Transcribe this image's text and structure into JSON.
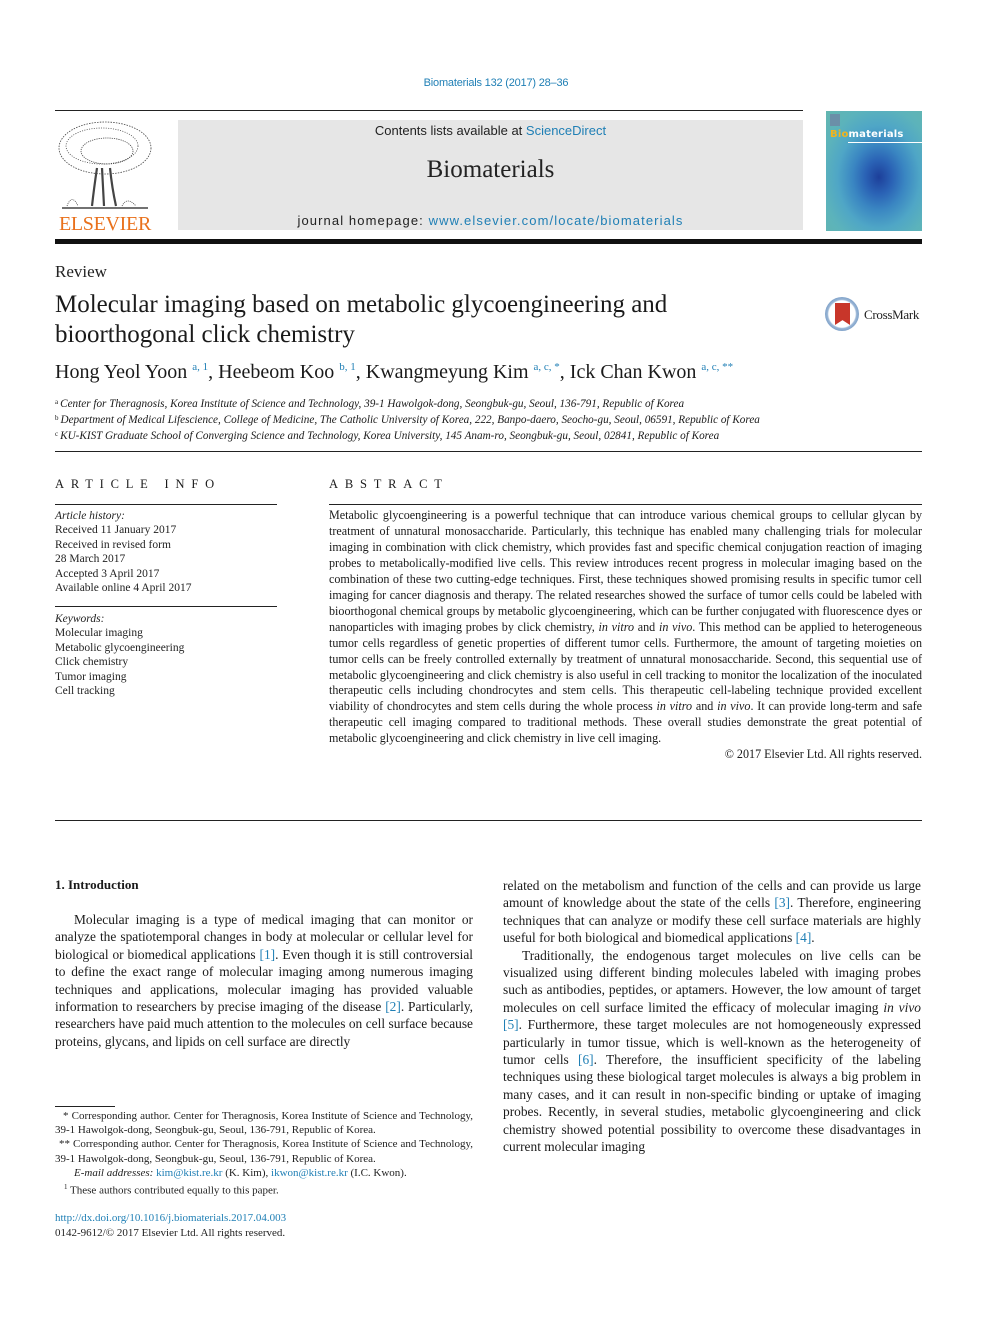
{
  "header": {
    "journal_ref": "Biomaterials 132 (2017) 28–36",
    "contents_prefix": "Contents lists available at ",
    "contents_link": "ScienceDirect",
    "journal_title": "Biomaterials",
    "homepage_prefix": "journal homepage: ",
    "homepage_link": "www.elsevier.com/locate/biomaterials",
    "publisher_logo_text": "ELSEVIER",
    "cover_title_highlight": "Bio",
    "cover_title_rest": "materials"
  },
  "article": {
    "type": "Review",
    "title": "Molecular imaging based on metabolic glycoengineering and bioorthogonal click chemistry",
    "crossmark_label": "CrossMark",
    "authors": [
      {
        "name": "Hong Yeol Yoon",
        "marks": "a, 1"
      },
      {
        "name": "Heebeom Koo",
        "marks": "b, 1"
      },
      {
        "name": "Kwangmeyung Kim",
        "marks": "a, c, *"
      },
      {
        "name": "Ick Chan Kwon",
        "marks": "a, c, **"
      }
    ],
    "affiliations": [
      {
        "key": "a",
        "text": "Center for Theragnosis, Korea Institute of Science and Technology, 39-1 Hawolgok-dong, Seongbuk-gu, Seoul, 136-791, Republic of Korea"
      },
      {
        "key": "b",
        "text": "Department of Medical Lifescience, College of Medicine, The Catholic University of Korea, 222, Banpo-daero, Seocho-gu, Seoul, 06591, Republic of Korea"
      },
      {
        "key": "c",
        "text": "KU-KIST Graduate School of Converging Science and Technology, Korea University, 145 Anam-ro, Seongbuk-gu, Seoul, 02841, Republic of Korea"
      }
    ]
  },
  "article_info": {
    "heading": "ARTICLE INFO",
    "history_label": "Article history:",
    "history": [
      "Received 11 January 2017",
      "Received in revised form",
      "28 March 2017",
      "Accepted 3 April 2017",
      "Available online 4 April 2017"
    ],
    "keywords_label": "Keywords:",
    "keywords": [
      "Molecular imaging",
      "Metabolic glycoengineering",
      "Click chemistry",
      "Tumor imaging",
      "Cell tracking"
    ]
  },
  "abstract": {
    "heading": "ABSTRACT",
    "seg1": "Metabolic glycoengineering is a powerful technique that can introduce various chemical groups to cellular glycan by treatment of unnatural monosaccharide. Particularly, this technique has enabled many challenging trials for molecular imaging in combination with click chemistry, which provides fast and specific chemical conjugation reaction of imaging probes to metabolically-modified live cells. This review introduces recent progress in molecular imaging based on the combination of these two cutting-edge techniques. First, these techniques showed promising results in specific tumor cell imaging for cancer diagnosis and therapy. The related researches showed the surface of tumor cells could be labeled with bioorthogonal chemical groups by metabolic glycoengineering, which can be further conjugated with fluorescence dyes or nanoparticles with imaging probes by click chemistry, ",
    "in_vitro": "in vitro",
    "and": " and ",
    "in_vivo": "in vivo",
    "seg2": ". This method can be applied to heterogeneous tumor cells regardless of genetic properties of different tumor cells. Furthermore, the amount of targeting moieties on tumor cells can be freely controlled externally by treatment of unnatural monosaccharide. Second, this sequential use of metabolic glycoengineering and click chemistry is also useful in cell tracking to monitor the localization of the inoculated therapeutic cells including chondrocytes and stem cells. This therapeutic cell-labeling technique provided excellent viability of chondrocytes and stem cells during the whole process ",
    "seg3": ". It can provide long-term and safe therapeutic cell imaging compared to traditional methods. These overall studies demonstrate the great potential of metabolic glycoengineering and click chemistry in live cell imaging.",
    "copyright": "© 2017 Elsevier Ltd. All rights reserved."
  },
  "introduction": {
    "heading": "1.  Introduction",
    "p1_a": "Molecular imaging is a type of medical imaging that can monitor or analyze the spatiotemporal changes in body at molecular or cellular level for biological or biomedical applications ",
    "ref1": "[1]",
    "p1_b": ". Even though it is still controversial to define the exact range of molecular imaging among numerous imaging techniques and applications, molecular imaging has provided valuable information to re­searchers by precise imaging of the disease ",
    "ref2": "[2]",
    "p1_c": ". Particularly, re­searchers have paid much attention to the molecules on cell surface because proteins, glycans, and lipids on cell surface are directly",
    "p1_d": "related on the metabolism and function of the cells and can provide us large amount of knowledge about the state of the cells ",
    "ref3": "[3]",
    "p1_e": ". Therefore, engineering techniques that can analyze or modify these cell surface materials are highly useful for both biological and biomedical applications ",
    "ref4": "[4]",
    "p1_f": ".",
    "p2_a": "Traditionally, the endogenous target molecules on live cells can be visualized using different binding molecules labeled with im­aging probes such as antibodies, peptides, or aptamers. However, the low amount of target molecules on cell surface limited the ef­ficacy of molecular imaging ",
    "p2_invivo": "in vivo",
    "ref5": "[5]",
    "p2_b": ". Furthermore, these target molecules are not homogeneously expressed particularly in tumor tissue, which is well-known as the heterogeneity of tumor cells ",
    "ref6": "[6]",
    "p2_c": ". Therefore, the insufficient specificity of the labeling techniques using these biological target molecules is always a big problem in many cases, and it can result in non-specific binding or uptake of imaging probes. Recently, in several studies, metabolic glyco­engineering and click chemistry showed potential possibility to overcome these disadvantages in current molecular imaging"
  },
  "footnotes": {
    "star1": "* Corresponding author. Center for Theragnosis, Korea Institute of Science and Technology, 39-1 Hawolgok-dong, Seongbuk-gu, Seoul, 136-791, Republic of Korea.",
    "star2": "** Corresponding author. Center for Theragnosis, Korea Institute of Science and Technology, 39-1 Hawolgok-dong, Seongbuk-gu, Seoul, 136-791, Republic of Korea.",
    "email_label": "E-mail addresses:",
    "email1": "kim@kist.re.kr",
    "email1_who": " (K. Kim), ",
    "email2": "ikwon@kist.re.kr",
    "email2_who": " (I.C. Kwon).",
    "equal_mark": "1",
    "equal": " These authors contributed equally to this paper."
  },
  "doi": {
    "link": "http://dx.doi.org/10.1016/j.biomaterials.2017.04.003",
    "issn_line": "0142-9612/© 2017 Elsevier Ltd. All rights reserved."
  }
}
